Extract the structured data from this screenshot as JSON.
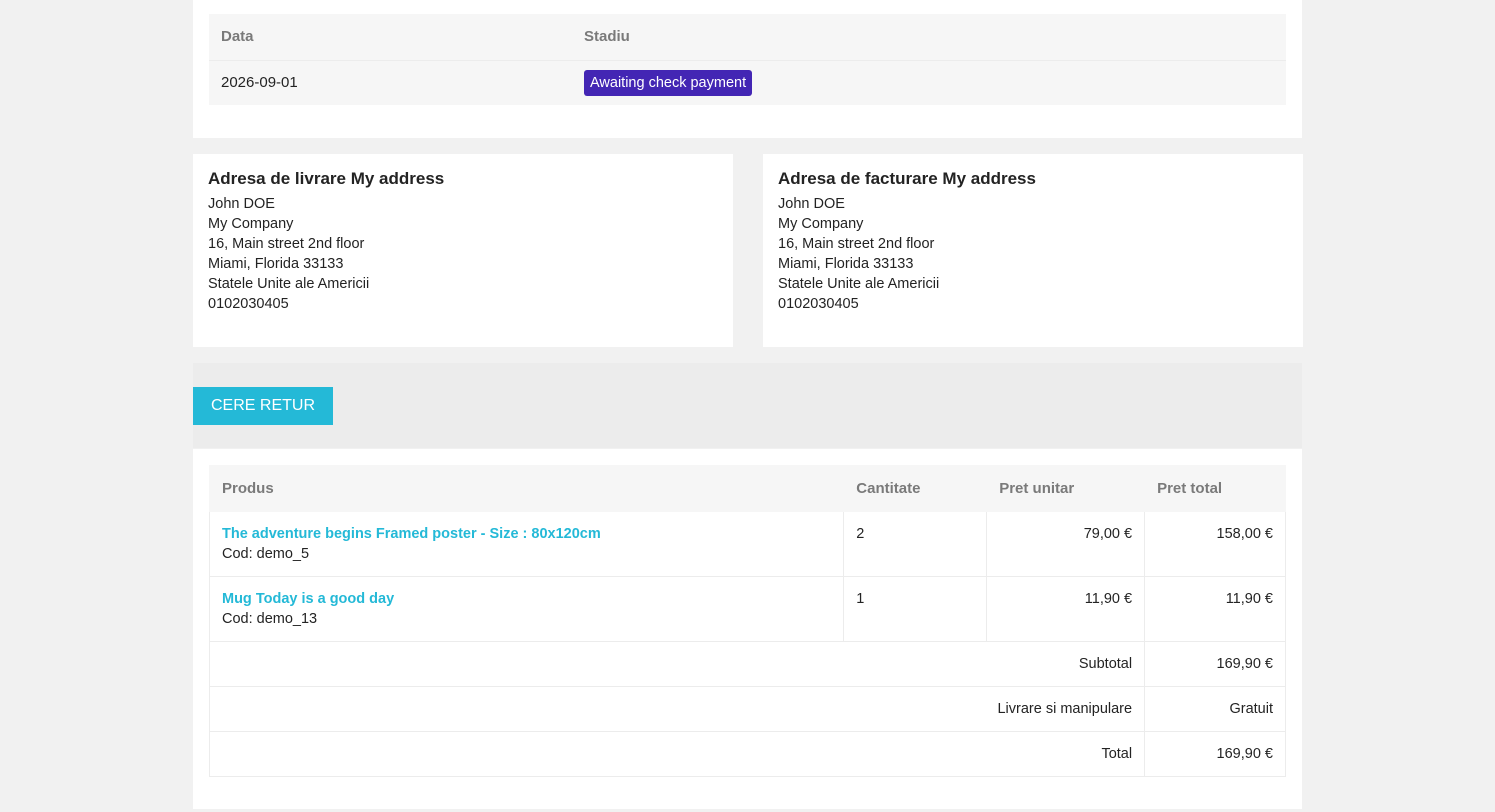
{
  "history": {
    "headers": {
      "date": "Data",
      "status": "Stadiu"
    },
    "rows": [
      {
        "date": "2026-09-01",
        "status": "Awaiting check payment"
      }
    ],
    "status_color": "#4326b4"
  },
  "delivery_address": {
    "title": "Adresa de livrare My address",
    "lines": [
      "John DOE",
      "My Company",
      "16, Main street 2nd floor",
      "Miami, Florida 33133",
      "Statele Unite ale Americii",
      "0102030405"
    ]
  },
  "invoice_address": {
    "title": "Adresa de facturare My address",
    "lines": [
      "John DOE",
      "My Company",
      "16, Main street 2nd floor",
      "Miami, Florida 33133",
      "Statele Unite ale Americii",
      "0102030405"
    ]
  },
  "return": {
    "button_label": "Cere retur",
    "accent": "#24b9d7"
  },
  "products": {
    "headers": {
      "product": "Produs",
      "quantity": "Cantitate",
      "unit_price": "Pret unitar",
      "total_price": "Pret total"
    },
    "items": [
      {
        "name": "The adventure begins Framed poster - Size : 80x120cm",
        "code": "Cod: demo_5",
        "quantity": "2",
        "unit_price": "79,00 €",
        "total_price": "158,00 €"
      },
      {
        "name": "Mug Today is a good day",
        "code": "Cod: demo_13",
        "quantity": "1",
        "unit_price": "11,90 €",
        "total_price": "11,90 €"
      }
    ],
    "totals": [
      {
        "label": "Subtotal",
        "value": "169,90 €"
      },
      {
        "label": "Livrare si manipulare",
        "value": "Gratuit"
      },
      {
        "label": "Total",
        "value": "169,90 €"
      }
    ]
  }
}
